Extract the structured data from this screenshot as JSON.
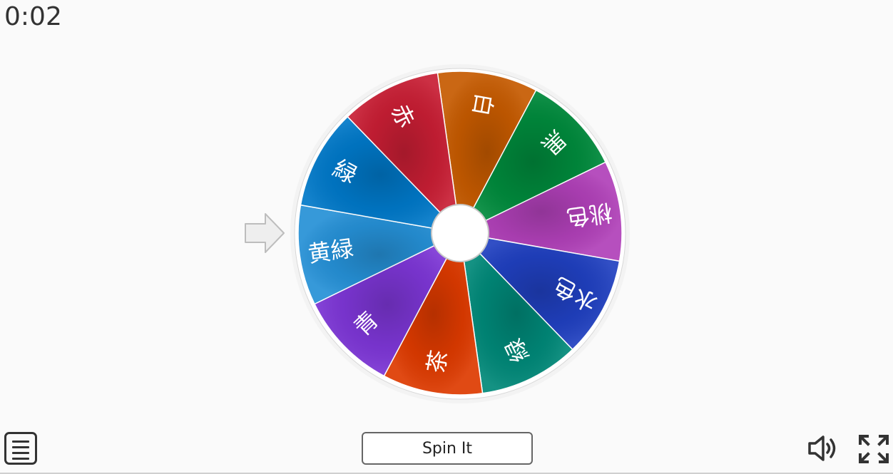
{
  "timer": {
    "text": "0:02"
  },
  "wheel": {
    "segments": [
      {
        "label": "白",
        "color": "#c55a00"
      },
      {
        "label": "黒",
        "color": "#008a3c"
      },
      {
        "label": "桃色",
        "color": "#b040b8"
      },
      {
        "label": "水色",
        "color": "#2040c0"
      },
      {
        "label": "緑",
        "color": "#008878"
      },
      {
        "label": "茶",
        "color": "#dd3a00"
      },
      {
        "label": "青",
        "color": "#7d36d6"
      },
      {
        "label": "黄緑",
        "color": "#2590d6"
      },
      {
        "label": "緑",
        "color": "#0078c8"
      },
      {
        "label": "赤",
        "color": "#c81e34"
      }
    ],
    "selected_label": "黄緑",
    "rim_color": "#ffffff",
    "hub_color": "#ffffff"
  },
  "controls": {
    "spin_label": "Spin It",
    "menu_icon": "hamburger-menu-icon",
    "sound_icon": "speaker-icon",
    "fullscreen_icon": "fullscreen-icon"
  },
  "pointer": {
    "icon": "arrow-right-icon",
    "color": "#eeeeee"
  }
}
